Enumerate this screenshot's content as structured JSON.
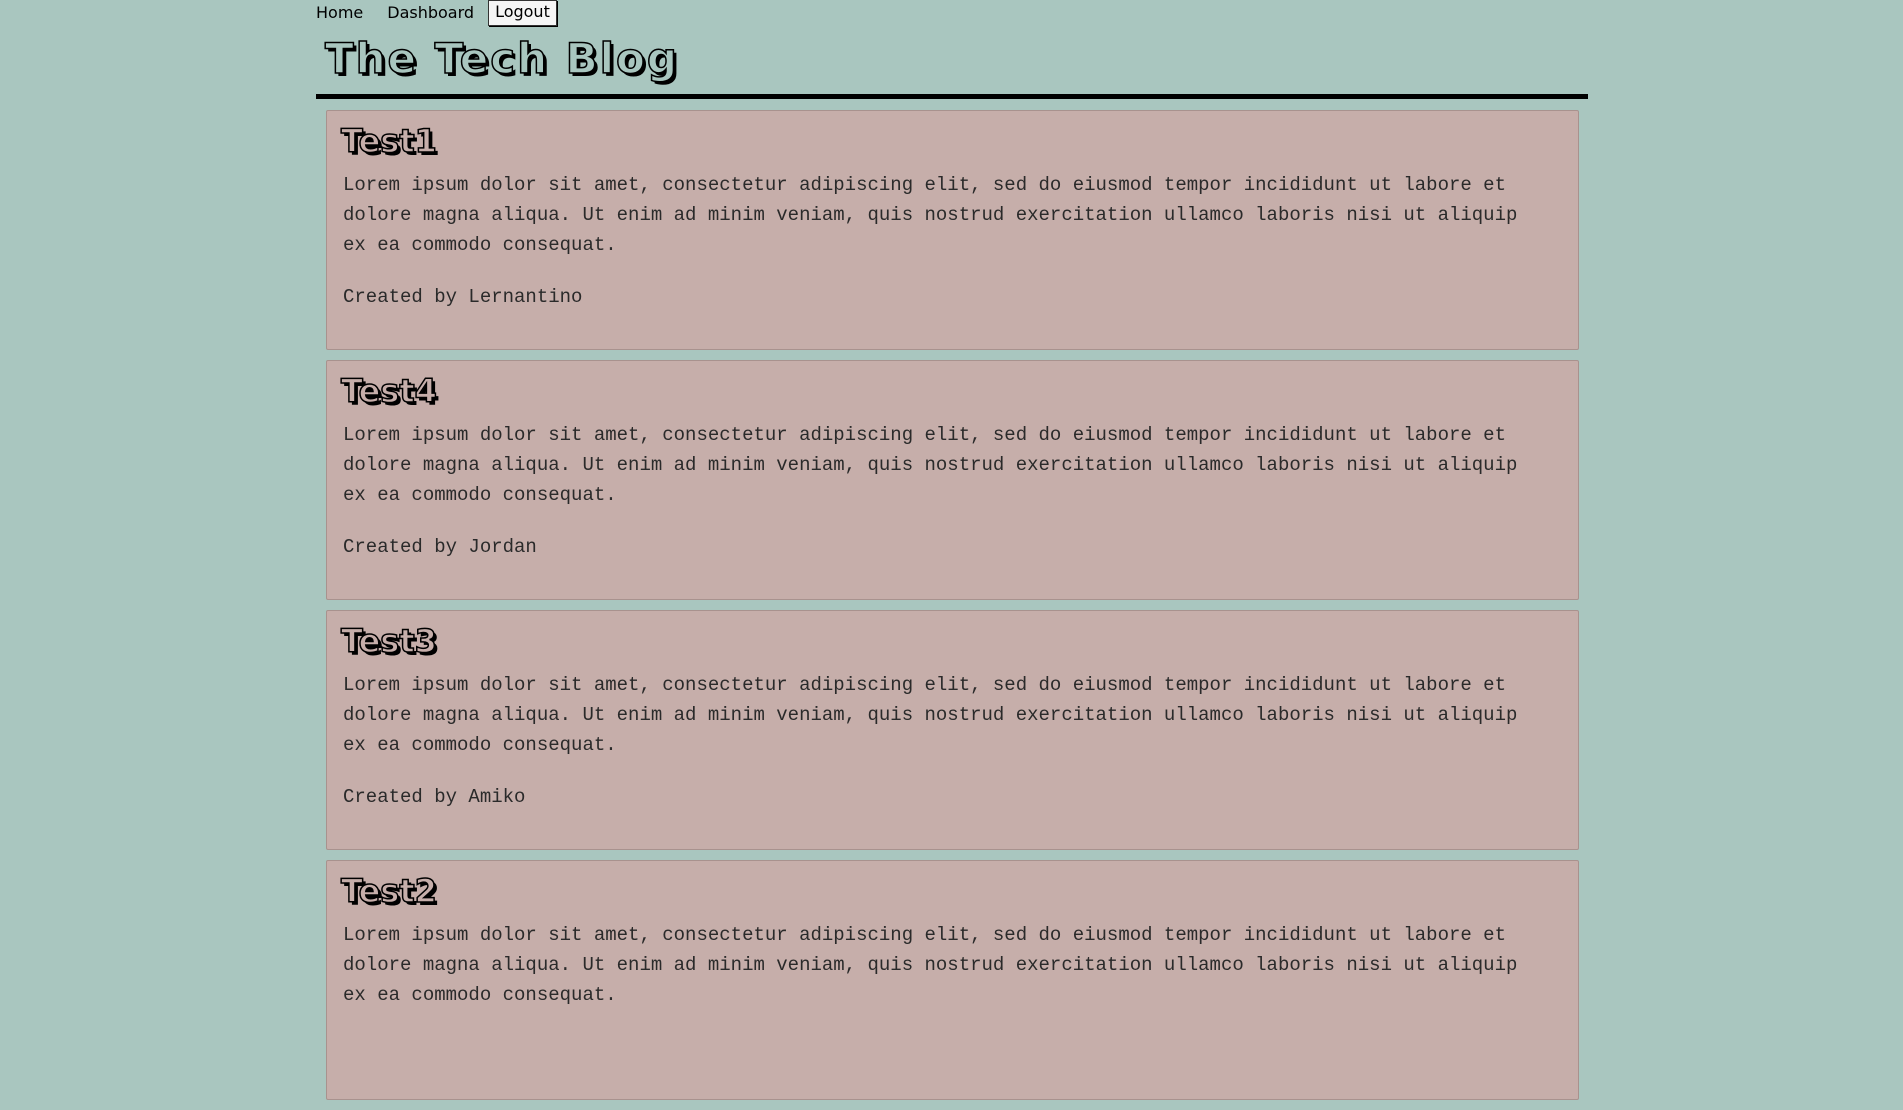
{
  "nav": {
    "home": "Home",
    "dashboard": "Dashboard",
    "logout": "Logout"
  },
  "site": {
    "title": "The Tech Blog"
  },
  "posts": [
    {
      "title": "Test1",
      "body": "Lorem ipsum dolor sit amet, consectetur adipiscing elit, sed do eiusmod tempor incididunt ut labore et dolore magna aliqua. Ut enim ad minim veniam, quis nostrud exercitation ullamco laboris nisi ut aliquip ex ea commodo consequat.",
      "author": "Created by Lernantino"
    },
    {
      "title": "Test4",
      "body": "Lorem ipsum dolor sit amet, consectetur adipiscing elit, sed do eiusmod tempor incididunt ut labore et dolore magna aliqua. Ut enim ad minim veniam, quis nostrud exercitation ullamco laboris nisi ut aliquip ex ea commodo consequat.",
      "author": "Created by Jordan"
    },
    {
      "title": "Test3",
      "body": "Lorem ipsum dolor sit amet, consectetur adipiscing elit, sed do eiusmod tempor incididunt ut labore et dolore magna aliqua. Ut enim ad minim veniam, quis nostrud exercitation ullamco laboris nisi ut aliquip ex ea commodo consequat.",
      "author": "Created by Amiko"
    },
    {
      "title": "Test2",
      "body": "Lorem ipsum dolor sit amet, consectetur adipiscing elit, sed do eiusmod tempor incididunt ut labore et dolore magna aliqua. Ut enim ad minim veniam, quis nostrud exercitation ullamco laboris nisi ut aliquip ex ea commodo consequat.",
      "author": ""
    }
  ],
  "colors": {
    "background": "#a9c6bf",
    "card": "#c6aeaa",
    "rule": "#000000"
  }
}
